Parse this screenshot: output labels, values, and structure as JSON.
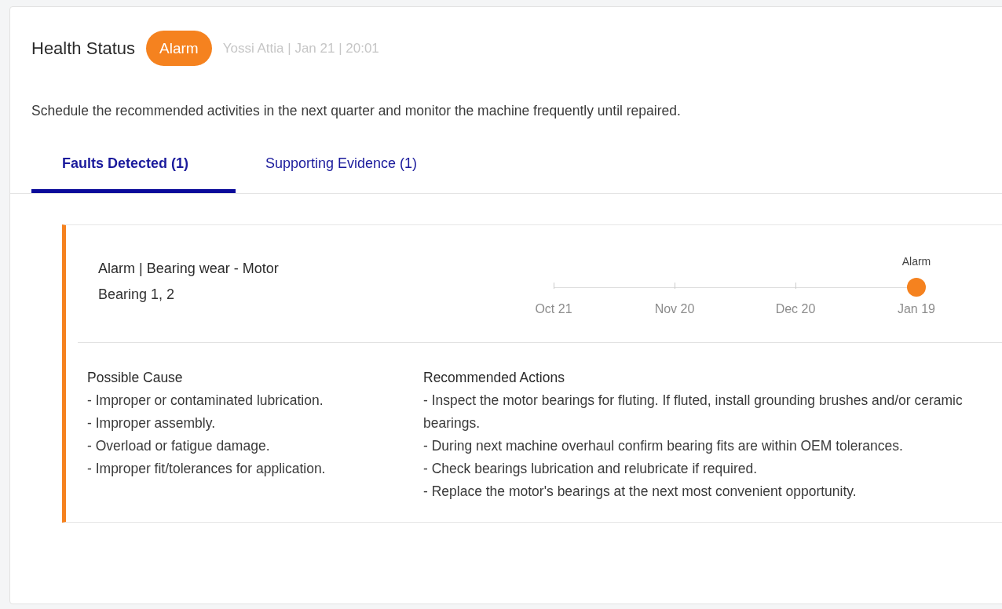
{
  "header": {
    "title": "Health Status",
    "badge": {
      "label": "Alarm",
      "kind": "alarm"
    },
    "meta": "Yossi Attia | Jan 21 | 20:01"
  },
  "summary": "Schedule the recommended activities in the next quarter and monitor the machine frequently until repaired.",
  "tabs": [
    {
      "label": "Faults Detected (1)",
      "selected": true
    },
    {
      "label": "Supporting Evidence (1)",
      "selected": false
    }
  ],
  "fault": {
    "kind": "alarm",
    "title": "Alarm | Bearing wear - Motor",
    "location": "Bearing 1, 2",
    "timeline": [
      {
        "label": "Oct 21"
      },
      {
        "label": "Nov 20"
      },
      {
        "label": "Dec 20"
      },
      {
        "label": "Jan 19",
        "event": "Alarm",
        "kind": "alarm"
      }
    ],
    "cause": {
      "heading": "Possible Cause",
      "items": [
        "- Improper or contaminated lubrication.",
        "- Improper assembly.",
        "- Overload or fatigue damage.",
        "- Improper fit/tolerances for application."
      ]
    },
    "actions": {
      "heading": "Recommended Actions",
      "items": [
        "- Inspect the motor bearings for fluting. If fluted, install grounding brushes and/or ceramic bearings.",
        "- During next machine overhaul confirm bearing fits are within OEM tolerances.",
        "- Check bearings lubrication and relubricate if required.",
        "- Replace the motor's bearings at the next most convenient opportunity."
      ]
    }
  }
}
